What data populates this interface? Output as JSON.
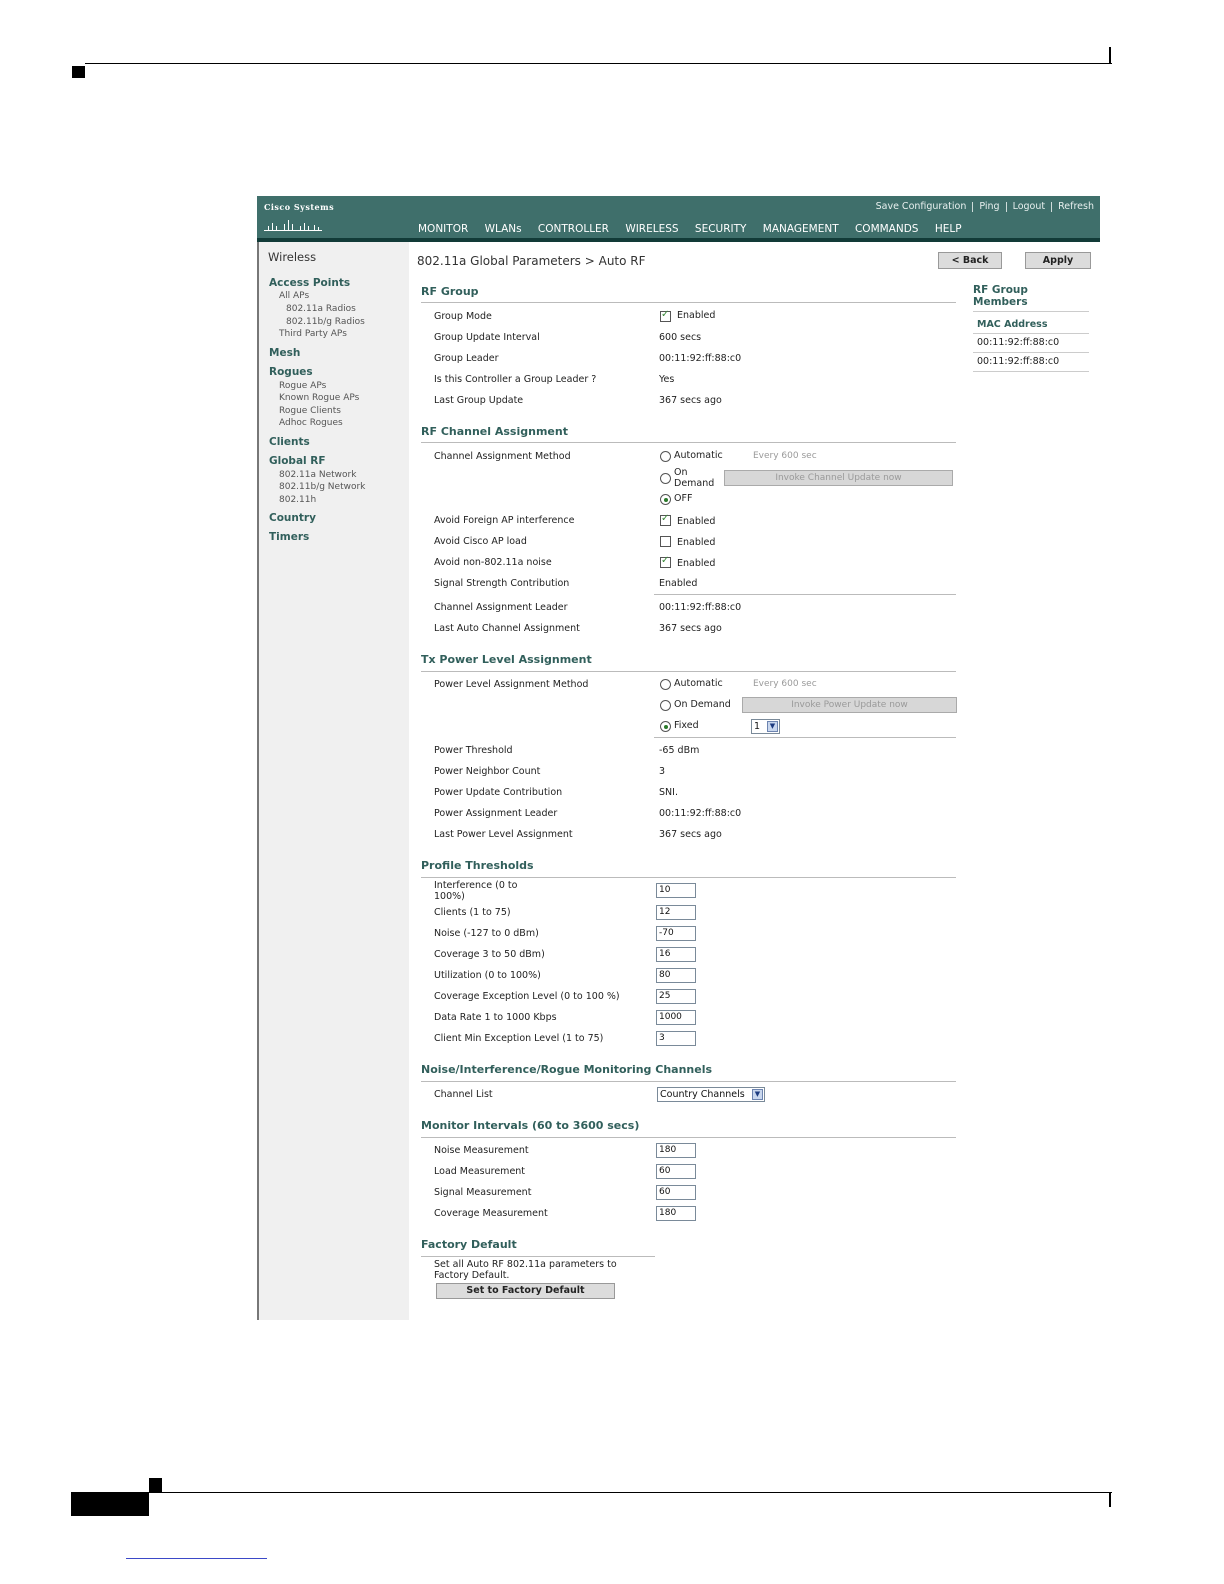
{
  "header": {
    "brand": "Cisco Systems",
    "links": [
      "Save Configuration",
      "Ping",
      "Logout",
      "Refresh"
    ],
    "nav": [
      "MONITOR",
      "WLANs",
      "CONTROLLER",
      "WIRELESS",
      "SECURITY",
      "MANAGEMENT",
      "COMMANDS",
      "HELP"
    ],
    "active_nav": "WIRELESS"
  },
  "sidebar": {
    "title": "Wireless",
    "access_points": "Access Points",
    "all_aps": "All APs",
    "radios_a": "802.11a Radios",
    "radios_bg": "802.11b/g Radios",
    "third_party": "Third Party APs",
    "mesh": "Mesh",
    "rogues": "Rogues",
    "rogue_aps": "Rogue APs",
    "known_rogue": "Known Rogue APs",
    "rogue_clients": "Rogue Clients",
    "adhoc": "Adhoc Rogues",
    "clients": "Clients",
    "global_rf": "Global RF",
    "net_a": "802.11a Network",
    "net_bg": "802.11b/g Network",
    "net_h": "802.11h",
    "country": "Country",
    "timers": "Timers"
  },
  "page": {
    "breadcrumb": "802.11a Global Parameters > Auto RF",
    "back_label": "< Back",
    "apply_label": "Apply"
  },
  "rf_group": {
    "heading": "RF Group",
    "mode_label": "Group Mode",
    "mode_value": "Enabled",
    "interval_label": "Group Update Interval",
    "interval_value": "600 secs",
    "leader_label": "Group Leader",
    "leader_value": "00:11:92:ff:88:c0",
    "is_leader_label": "Is this Controller a Group Leader ?",
    "is_leader_value": "Yes",
    "last_update_label": "Last Group Update",
    "last_update_value": "367 secs ago"
  },
  "channel": {
    "heading": "RF Channel Assignment",
    "method_label": "Channel Assignment Method",
    "opt_auto": "Automatic",
    "auto_hint": "Every 600 sec",
    "opt_ondemand_1": "On",
    "opt_ondemand_2": "Demand",
    "invoke_label": "Invoke Channel Update now",
    "opt_off": "OFF",
    "selected": "OFF",
    "foreign_label": "Avoid Foreign AP interference",
    "cisco_load_label": "Avoid Cisco AP load",
    "noise_label": "Avoid non-802.11a noise",
    "enabled_text": "Enabled",
    "foreign_checked": true,
    "cisco_load_checked": false,
    "noise_checked": true,
    "signal_label": "Signal Strength Contribution",
    "signal_value": "Enabled",
    "leader_label": "Channel Assignment Leader",
    "leader_value": "00:11:92:ff:88:c0",
    "last_label": "Last Auto Channel Assignment",
    "last_value": "367 secs ago"
  },
  "power": {
    "heading": "Tx Power Level Assignment",
    "method_label": "Power Level Assignment Method",
    "opt_auto": "Automatic",
    "auto_hint": "Every 600 sec",
    "opt_ondemand": "On Demand",
    "invoke_label": "Invoke Power Update now",
    "opt_fixed": "Fixed",
    "fixed_value": "1",
    "selected": "Fixed",
    "threshold_label": "Power Threshold",
    "threshold_value": "-65 dBm",
    "neighbor_label": "Power Neighbor Count",
    "neighbor_value": "3",
    "contrib_label": "Power Update Contribution",
    "contrib_value": "SNI.",
    "leader_label": "Power Assignment Leader",
    "leader_value": "00:11:92:ff:88:c0",
    "last_label": "Last Power Level Assignment",
    "last_value": "367 secs ago"
  },
  "profile": {
    "heading": "Profile Thresholds",
    "interference_label_1": "Interference (0 to",
    "interference_label_2": "100%)",
    "interference_value": "10",
    "clients_label": "Clients (1 to 75)",
    "clients_value": "12",
    "noise_label": "Noise (-127 to 0 dBm)",
    "noise_value": "-70",
    "coverage_label": "Coverage 3 to 50 dBm)",
    "coverage_value": "16",
    "utilization_label": "Utilization (0 to 100%)",
    "utilization_value": "80",
    "cov_exc_label": "Coverage Exception Level (0 to 100 %)",
    "cov_exc_value": "25",
    "data_rate_label": "Data Rate 1 to 1000 Kbps",
    "data_rate_value": "1000",
    "client_min_label": "Client Min Exception Level (1 to 75)",
    "client_min_value": "3"
  },
  "monitoring": {
    "heading": "Noise/Interference/Rogue Monitoring Channels",
    "channel_list_label": "Channel List",
    "channel_list_value": "Country Channels"
  },
  "intervals": {
    "heading": "Monitor Intervals (60 to 3600 secs)",
    "noise_label": "Noise Measurement",
    "noise_value": "180",
    "load_label": "Load Measurement",
    "load_value": "60",
    "signal_label": "Signal Measurement",
    "signal_value": "60",
    "coverage_label": "Coverage Measurement",
    "coverage_value": "180"
  },
  "factory": {
    "heading": "Factory Default",
    "desc_1": "Set all Auto RF 802.11a parameters to",
    "desc_2": "Factory Default.",
    "button_label": "Set to Factory Default"
  },
  "rf_group_members": {
    "title_1": "RF Group",
    "title_2": "Members",
    "header": "MAC Address",
    "macs": [
      "00:11:92:ff:88:c0",
      "00:11:92:ff:88:c0"
    ]
  },
  "figure_id": "146937"
}
